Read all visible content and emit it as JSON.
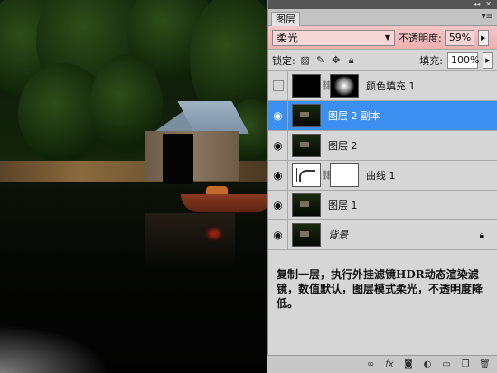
{
  "panel": {
    "tab": "图层",
    "blend_mode": "柔光",
    "opacity_label": "不透明度:",
    "opacity_value": "59%",
    "lock_label": "锁定:",
    "fill_label": "填充:",
    "fill_value": "100%"
  },
  "layers": [
    {
      "name": "颜色填充 1",
      "visible": false,
      "thumb": "black",
      "mask": "radial",
      "selected": false
    },
    {
      "name": "图层 2 副本",
      "visible": true,
      "thumb": "landscape",
      "selected": true
    },
    {
      "name": "图层 2",
      "visible": true,
      "thumb": "landscape",
      "selected": false
    },
    {
      "name": "曲线 1",
      "visible": true,
      "thumb": "curves",
      "mask": "white",
      "selected": false
    },
    {
      "name": "图层 1",
      "visible": true,
      "thumb": "landscape",
      "selected": false
    },
    {
      "name": "背景",
      "visible": true,
      "thumb": "landscape",
      "locked": true,
      "selected": false
    }
  ],
  "note": {
    "text": "复制一层，执行外挂滤镜HDR动态渲染滤镜，数值默认，图层模式柔光，不透明度降低。"
  },
  "icons": {
    "eye": "eye-icon",
    "chain": "link-icon",
    "lock": "lock-icon",
    "bottom": [
      "link-layers-icon",
      "fx-icon",
      "add-mask-icon",
      "adjustment-icon",
      "group-icon",
      "new-layer-icon",
      "trash-icon"
    ]
  }
}
